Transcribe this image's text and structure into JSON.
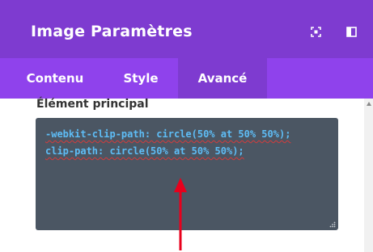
{
  "header": {
    "title": "Image Paramètres",
    "icons": [
      "expand-icon",
      "sidebar-layout-icon"
    ]
  },
  "tabs": [
    {
      "label": "Contenu",
      "active": false
    },
    {
      "label": "Style",
      "active": false
    },
    {
      "label": "Avancé",
      "active": true
    }
  ],
  "field": {
    "label": "Élément principal",
    "code_lines": [
      "-webkit-clip-path: circle(50% at 50% 50%);",
      "clip-path: circle(50% at 50% 50%);"
    ]
  },
  "colors": {
    "header_bg": "#7e3bd0",
    "tabs_bg": "#8f42ec",
    "code_bg": "#4b5663",
    "code_text": "#5ebdf6",
    "arrow": "#e8001c"
  }
}
